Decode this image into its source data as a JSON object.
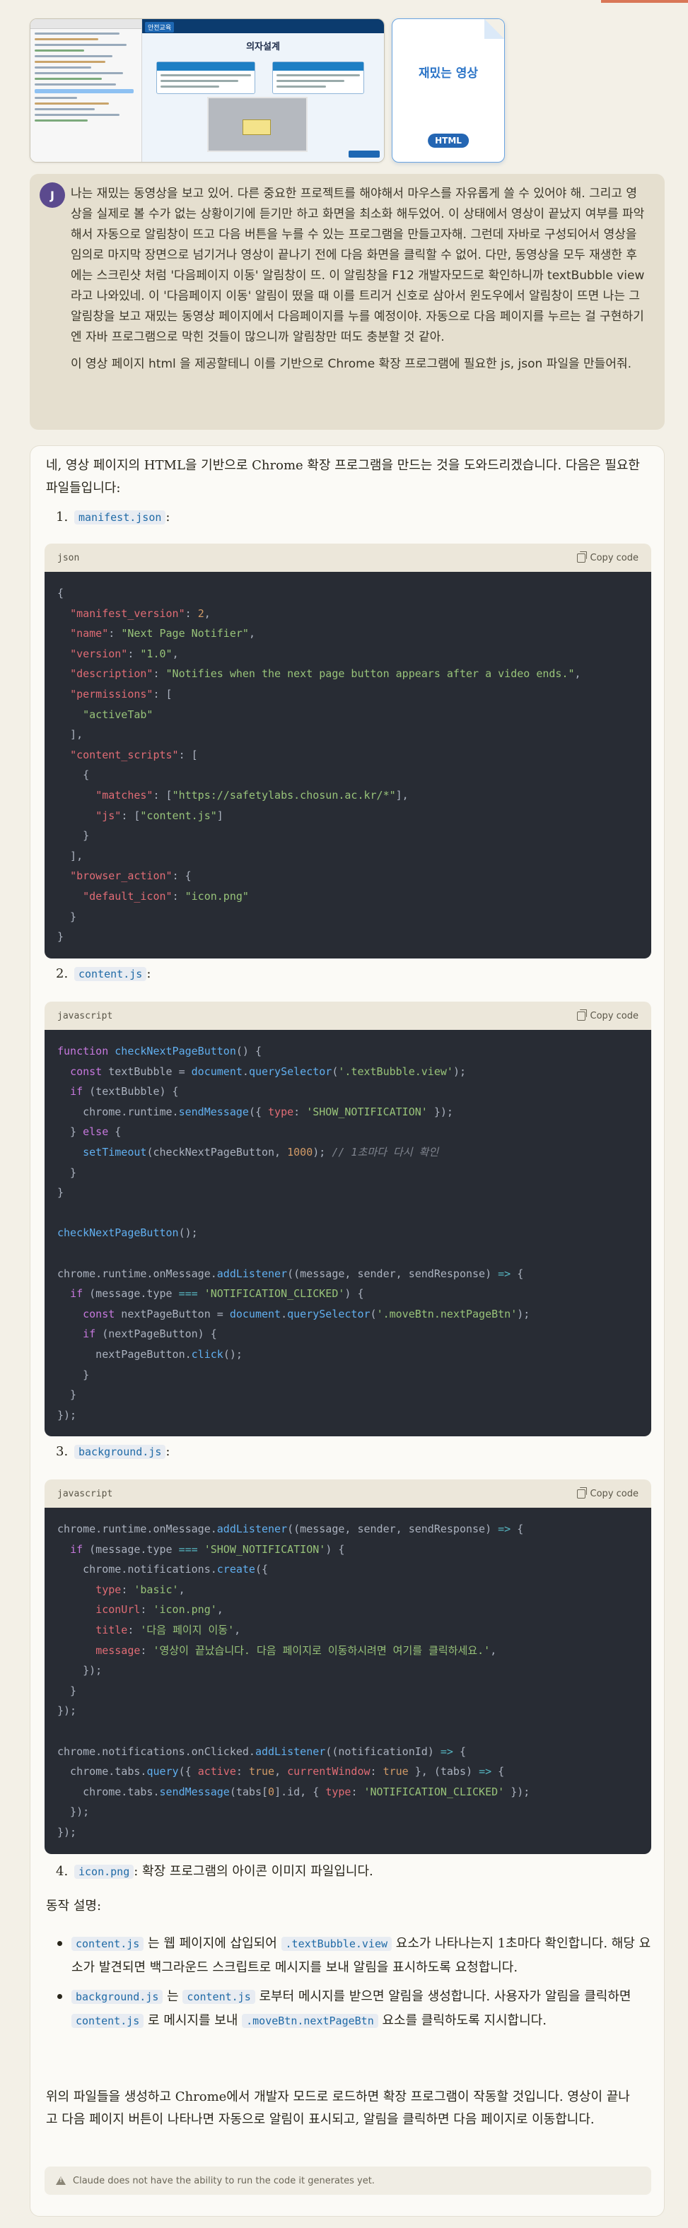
{
  "attachments": {
    "screenshot": {
      "tag": "안전교육",
      "slide_title": "의자설계"
    },
    "file": {
      "name": "재밌는 영상",
      "type": "HTML"
    }
  },
  "user": {
    "avatar_letter": "J",
    "paragraph1": "나는 재밌는 동영상을 보고 있어. 다른 중요한 프로젝트를 해야해서 마우스를 자유롭게 쓸 수 있어야 해. 그리고 영상을 실제로 볼 수가 없는 상황이기에 듣기만 하고 화면을 최소화 해두었어. 이 상태에서 영상이 끝났지 여부를 파악해서 자동으로 알림창이 뜨고 다음 버튼을 누를 수 있는 프로그램을 만들고자해. 그런데 자바로 구성되어서 영상을 임의로 마지막 장면으로 넘기거나 영상이 끝나기 전에 다음 화면을 클릭할 수 없어. 다만, 동영상을 모두 재생한 후에는 스크린샷 처럼 '다음페이지 이동' 알림창이 뜨. 이 알림창을 F12 개발자모드로 확인하니까 textBubble view 라고 나와있네. 이 '다음페이지 이동' 알림이 떴을 때 이를 트리거 신호로 삼아서 윈도우에서 알림창이 뜨면 나는 그 알림창을 보고 재밌는 동영상 페이지에서 다음페이지를 누를 예정이야. 자동으로 다음 페이지를 누르는 걸 구현하기엔 자바 프로그램으로 막힌 것들이 많으니까 알림창만 떠도 충분할 것 같아.",
    "paragraph2": "이 영상 페이지 html 을 제공할테니 이를 기반으로 Chrome 확장 프로그램에 필요한 js, json 파일을 만들어줘."
  },
  "assistant": {
    "intro": "네, 영상 페이지의 HTML을 기반으로 Chrome 확장 프로그램을 만드는 것을 도와드리겠습니다. 다음은 필요한 파일들입니다:",
    "steps": [
      {
        "num": "1.",
        "file": "manifest.json",
        "suffix": ":"
      },
      {
        "num": "2.",
        "file": "content.js",
        "suffix": ":"
      },
      {
        "num": "3.",
        "file": "background.js",
        "suffix": ":"
      },
      {
        "num": "4.",
        "file": "icon.png",
        "suffix": ": 확장 프로그램의 아이콘 이미지 파일입니다."
      }
    ],
    "code_blocks": [
      {
        "lang": "json",
        "copy_label": "Copy code"
      },
      {
        "lang": "javascript",
        "copy_label": "Copy code"
      },
      {
        "lang": "javascript",
        "copy_label": "Copy code"
      }
    ],
    "explain_title": "동작 설명:",
    "bullet1": {
      "c1": "content.js",
      "t1": " 는 웹 페이지에 삽입되어 ",
      "c2": ".textBubble.view",
      "t2": " 요소가 나타나는지 1초마다 확인합니다. 해당 요소가 발견되면 백그라운드 스크립트로 메시지를 보내 알림을 표시하도록 요청합니다."
    },
    "bullet2": {
      "c1": "background.js",
      "t1": " 는 ",
      "c2": "content.js",
      "t2": " 로부터 메시지를 받으면 알림을 생성합니다. 사용자가 알림을 클릭하면 ",
      "c3": "content.js",
      "t3": " 로 메시지를 보내 ",
      "c4": ".moveBtn.nextPageBtn",
      "t4": " 요소를 클릭하도록 지시합니다."
    },
    "closing": "위의 파일들을 생성하고 Chrome에서 개발자 모드로 로드하면 확장 프로그램이 작동할 것입니다. 영상이 끝나고 다음 페이지 버튼이 나타나면 자동으로 알림이 표시되고, 알림을 클릭하면 다음 페이지로 이동합니다.",
    "disclaimer": "Claude does not have the ability to run the code it generates yet."
  }
}
